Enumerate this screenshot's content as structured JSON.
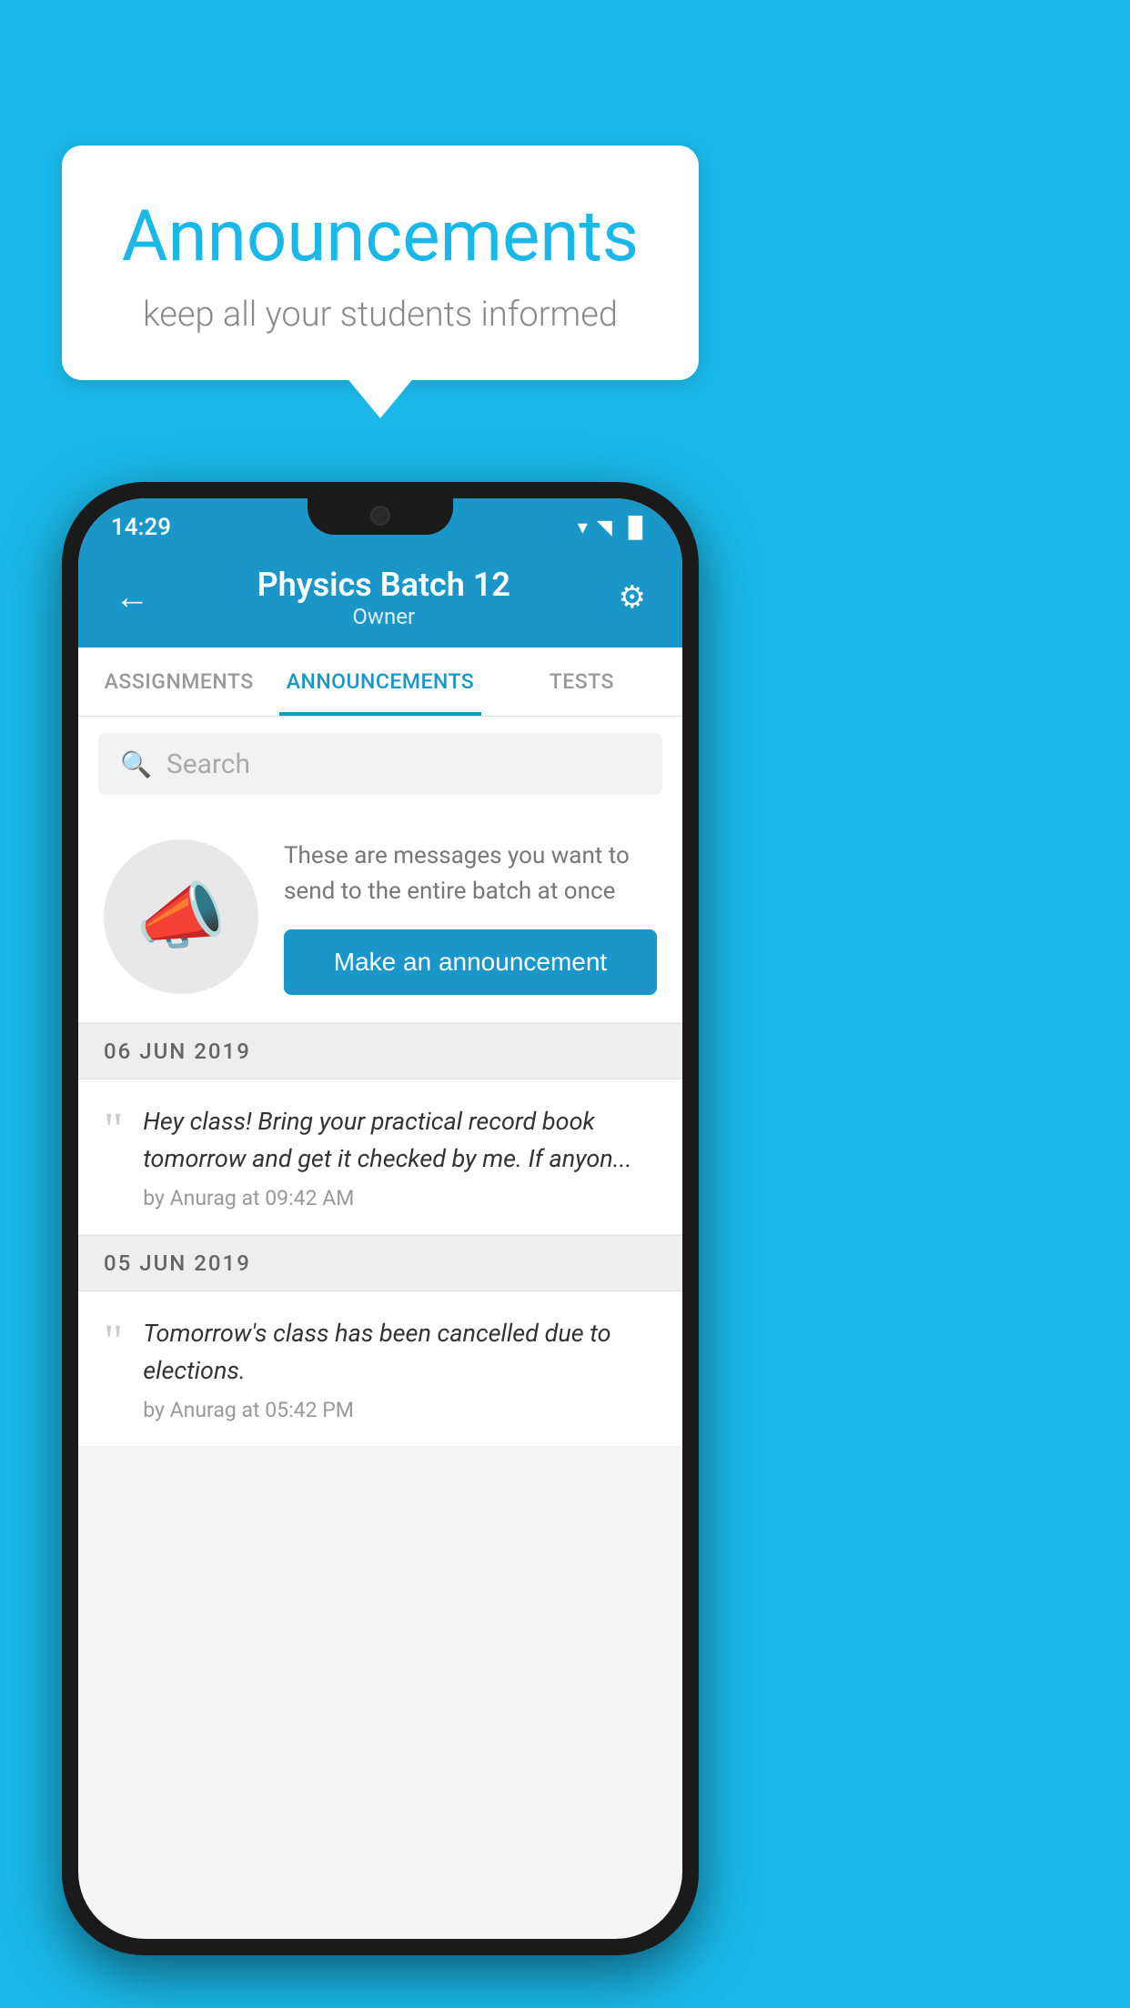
{
  "background_color": "#1ab8e8",
  "bubble": {
    "title": "Announcements",
    "subtitle": "keep all your students informed"
  },
  "status_bar": {
    "time": "14:29",
    "wifi": "▼",
    "signal": "▲",
    "battery": "▐"
  },
  "app_bar": {
    "title": "Physics Batch 12",
    "subtitle": "Owner",
    "back_label": "←",
    "settings_label": "⚙"
  },
  "tabs": [
    {
      "label": "ASSIGNMENTS",
      "active": false
    },
    {
      "label": "ANNOUNCEMENTS",
      "active": true
    },
    {
      "label": "TESTS",
      "active": false
    }
  ],
  "search": {
    "placeholder": "Search"
  },
  "promo": {
    "description": "These are messages you want to send to the entire batch at once",
    "button_label": "Make an announcement"
  },
  "announcements": [
    {
      "date": "06  JUN  2019",
      "text": "Hey class! Bring your practical record book tomorrow and get it checked by me. If anyon...",
      "meta": "by Anurag at 09:42 AM"
    },
    {
      "date": "05  JUN  2019",
      "text": "Tomorrow's class has been cancelled due to elections.",
      "meta": "by Anurag at 05:42 PM"
    }
  ]
}
